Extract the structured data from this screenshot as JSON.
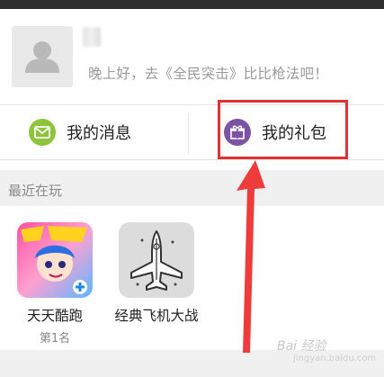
{
  "profile": {
    "greeting": "晚上好，去《全民突击》比比枪法吧！"
  },
  "actions": {
    "messages_label": "我的消息",
    "gifts_label": "我的礼包"
  },
  "recent": {
    "section_title": "最近在玩",
    "games": [
      {
        "name": "天天酷跑",
        "rank": "第1名"
      },
      {
        "name": "经典飞机大战",
        "rank": ""
      }
    ]
  },
  "next_section_title": "",
  "watermark": {
    "text": "Bai 经验",
    "sub": "jingyan.baidu.com"
  },
  "colors": {
    "message_icon_bg": "#8cc43b",
    "gift_icon_bg": "#7a53a5",
    "highlight_border": "#e03234",
    "arrow": "#ee3b3b"
  }
}
